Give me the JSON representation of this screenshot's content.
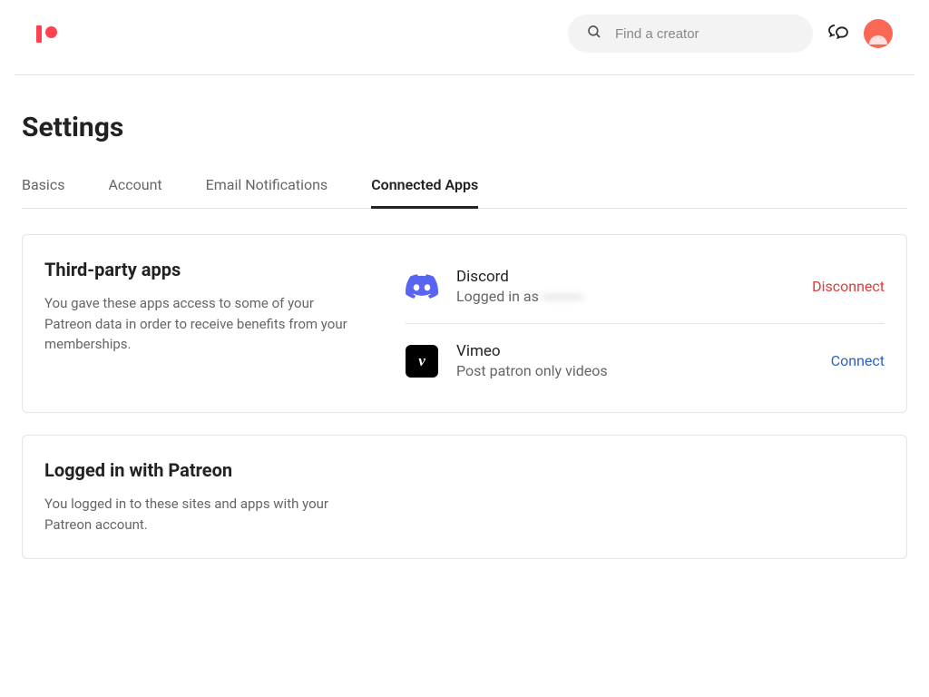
{
  "header": {
    "search_placeholder": "Find a creator"
  },
  "page_title": "Settings",
  "tabs": [
    {
      "label": "Basics",
      "active": false
    },
    {
      "label": "Account",
      "active": false
    },
    {
      "label": "Email Notifications",
      "active": false
    },
    {
      "label": "Connected Apps",
      "active": true
    }
  ],
  "third_party": {
    "title": "Third-party apps",
    "description": "You gave these apps access to some of your Patreon data in order to receive benefits from your memberships.",
    "apps": [
      {
        "name": "Discord",
        "desc_prefix": "Logged in as ",
        "desc_blur": "----------",
        "action_label": "Disconnect",
        "action_type": "disconnect"
      },
      {
        "name": "Vimeo",
        "desc": "Post patron only videos",
        "action_label": "Connect",
        "action_type": "connect"
      }
    ]
  },
  "logged_in": {
    "title": "Logged in with Patreon",
    "description": "You logged in to these sites and apps with your Patreon account."
  }
}
